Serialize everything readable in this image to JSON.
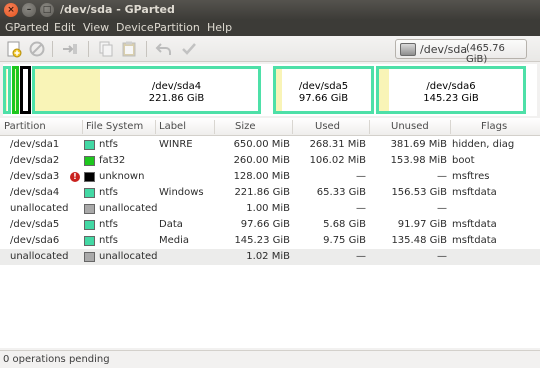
{
  "window": {
    "title": "/dev/sda - GParted",
    "close_glyph": "×",
    "min_glyph": "–",
    "max_glyph": "□"
  },
  "menu": [
    "GParted",
    "Edit",
    "View",
    "Device",
    "Partition",
    "Help"
  ],
  "toolbar": {
    "icons": [
      "new-partition-icon",
      "delete-partition-icon",
      "resize-move-icon",
      "copy-icon",
      "paste-icon",
      "undo-icon",
      "apply-icon"
    ]
  },
  "device_selector": {
    "device": "/dev/sda",
    "size": "(465.76 GiB)"
  },
  "disk_map": {
    "accent_border": "#4ee0a8",
    "used_fill": "#f9f4b7",
    "partitions": [
      {
        "name": "/dev/sda4",
        "size": "221.86 GiB",
        "used_fraction": 0.29
      },
      {
        "name": "/dev/sda5",
        "size": "97.66 GiB",
        "used_fraction": 0.06
      },
      {
        "name": "/dev/sda6",
        "size": "145.23 GiB",
        "used_fraction": 0.07
      }
    ]
  },
  "table": {
    "headers": [
      "Partition",
      "File System",
      "Label",
      "Size",
      "Used",
      "Unused",
      "Flags"
    ],
    "rows": [
      {
        "partition": "/dev/sda1",
        "fs": "ntfs",
        "fs_color": "#43d8a4",
        "label": "WINRE",
        "size": "650.00 MiB",
        "used": "268.31 MiB",
        "unused": "381.69 MiB",
        "flags": "hidden, diag"
      },
      {
        "partition": "/dev/sda2",
        "fs": "fat32",
        "fs_color": "#1ec71e",
        "label": "",
        "size": "260.00 MiB",
        "used": "106.02 MiB",
        "unused": "153.98 MiB",
        "flags": "boot"
      },
      {
        "partition": "/dev/sda3",
        "fs": "unknown",
        "fs_color": "#000000",
        "label": "",
        "size": "128.00 MiB",
        "used": "—",
        "unused": "—",
        "flags": "msftres",
        "warning": true
      },
      {
        "partition": "/dev/sda4",
        "fs": "ntfs",
        "fs_color": "#43d8a4",
        "label": "Windows",
        "size": "221.86 GiB",
        "used": "65.33 GiB",
        "unused": "156.53 GiB",
        "flags": "msftdata"
      },
      {
        "partition": "unallocated",
        "fs": "unallocated",
        "fs_color": "#a9a9a9",
        "label": "",
        "size": "1.00 MiB",
        "used": "—",
        "unused": "—",
        "flags": ""
      },
      {
        "partition": "/dev/sda5",
        "fs": "ntfs",
        "fs_color": "#43d8a4",
        "label": "Data",
        "size": "97.66 GiB",
        "used": "5.68 GiB",
        "unused": "91.97 GiB",
        "flags": "msftdata"
      },
      {
        "partition": "/dev/sda6",
        "fs": "ntfs",
        "fs_color": "#43d8a4",
        "label": "Media",
        "size": "145.23 GiB",
        "used": "9.75 GiB",
        "unused": "135.48 GiB",
        "flags": "msftdata"
      },
      {
        "partition": "unallocated",
        "fs": "unallocated",
        "fs_color": "#a9a9a9",
        "label": "",
        "size": "1.02 MiB",
        "used": "—",
        "unused": "—",
        "flags": "",
        "selected": true
      }
    ]
  },
  "status": {
    "text": "0 operations pending"
  }
}
